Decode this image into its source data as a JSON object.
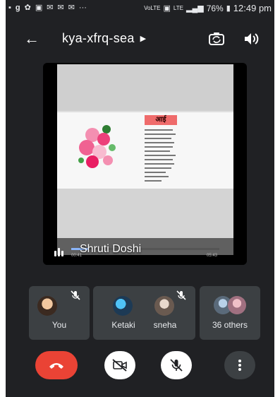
{
  "status_bar": {
    "battery": "76%",
    "time": "12:49 pm"
  },
  "header": {
    "meeting_code": "kya-xfrq-sea"
  },
  "presentation": {
    "slide_title": "आई",
    "presenter": "Shruti Doshi",
    "elapsed": "00:41",
    "duration": "05:43"
  },
  "participants": [
    {
      "label": "You",
      "avatar_color": "#f2c8a0"
    },
    {
      "label": "Ketaki",
      "avatar_color": "#1d3a55"
    },
    {
      "label": "sneha",
      "avatar_color": "#c9c0b8"
    },
    {
      "label": "36 others",
      "avatar_color": "#b8d0e8"
    }
  ],
  "colors": {
    "background": "#202124",
    "tile": "#3c4043",
    "end_call": "#ea4335"
  }
}
